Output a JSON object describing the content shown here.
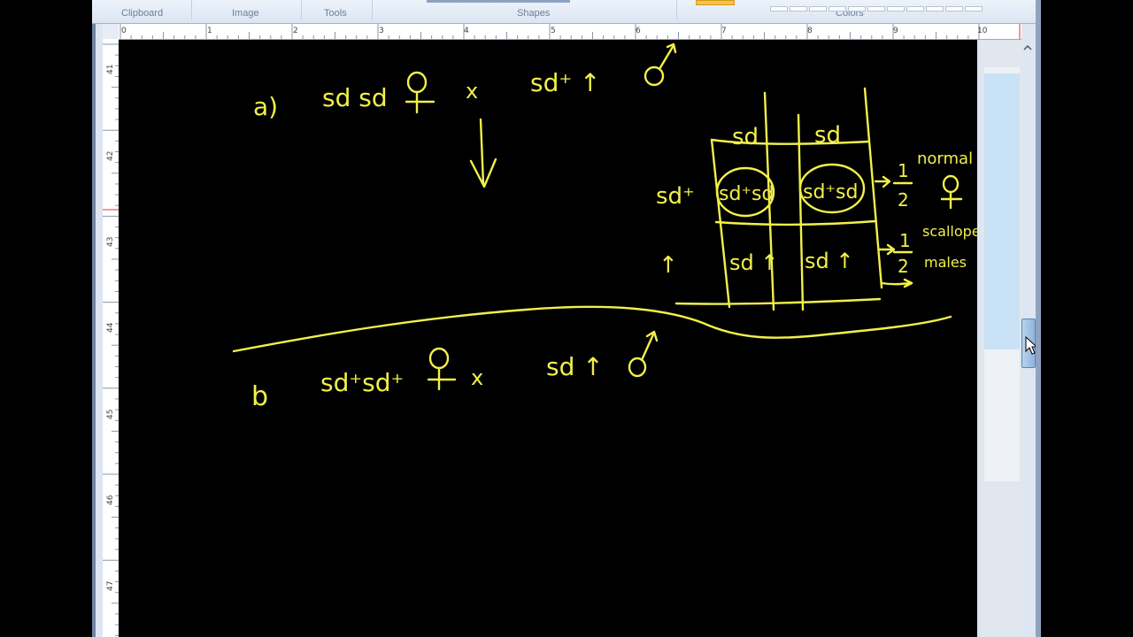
{
  "ribbon": {
    "groups": [
      "Clipboard",
      "Image",
      "Tools",
      "Shapes",
      "Colors"
    ]
  },
  "rulers": {
    "horizontal_ticks": [
      "0",
      "1",
      "2",
      "3",
      "4",
      "5",
      "6",
      "7",
      "8",
      "9",
      "10"
    ],
    "vertical_ticks": [
      "41",
      "42",
      "43",
      "44",
      "45",
      "46",
      "47"
    ]
  },
  "colors": {
    "ink": "#f2f04a",
    "canvas": "#000000",
    "ribbon": "#dbe5f2"
  },
  "notes": {
    "part_a": {
      "label": "a)",
      "female": "sd sd",
      "cross": "x",
      "male": "sd⁺ ↑"
    },
    "punnett": {
      "col_headers": [
        "sd",
        "sd"
      ],
      "row_headers": [
        "sd⁺",
        "↑"
      ],
      "cells": [
        [
          "sd⁺sd",
          "sd⁺sd"
        ],
        [
          "sd ↑",
          "sd ↑"
        ]
      ],
      "outcome_1": {
        "fraction_num": "1",
        "fraction_den": "2",
        "text": "normal"
      },
      "outcome_2": {
        "fraction_num": "1",
        "fraction_den": "2",
        "text_1": "scalloped",
        "text_2": "males"
      }
    },
    "part_b": {
      "label": "b",
      "female": "sd⁺sd⁺",
      "cross": "x",
      "male": "sd ↑"
    }
  }
}
